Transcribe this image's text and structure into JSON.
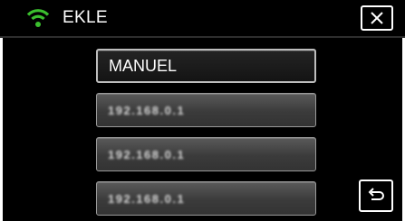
{
  "header": {
    "title": "EKLE",
    "wifi_icon": "wifi-icon",
    "close_icon": "close-icon",
    "wifi_color": "#3bbf2e"
  },
  "list": {
    "items": [
      {
        "label": "MANUEL",
        "selected": true
      },
      {
        "label": "192.168.0.1",
        "selected": false
      },
      {
        "label": "192.168.0.1",
        "selected": false
      },
      {
        "label": "192.168.0.1",
        "selected": false
      }
    ]
  },
  "footer": {
    "back_icon": "return-icon"
  }
}
